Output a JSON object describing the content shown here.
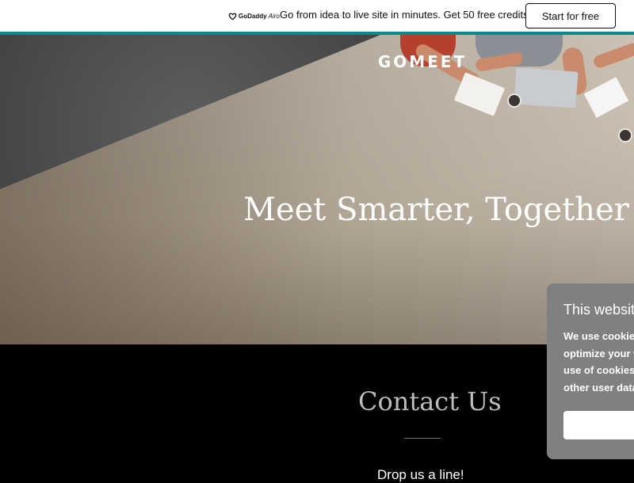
{
  "promo": {
    "logo_text": "GoDaddy",
    "logo_suffix": "Airo",
    "message": "Go from idea to live site in minutes. Get 50 free credits",
    "cta_label": "Start for free",
    "accent_color": "#0b8a8e"
  },
  "hero": {
    "brand": "GOMEET",
    "headline": "Meet Smarter, Together"
  },
  "contact": {
    "title": "Contact Us",
    "subtitle": "Drop us a line!"
  },
  "cookie_banner": {
    "title": "This websit",
    "body_lines": [
      "We use cookies",
      "optimize your w",
      "use of cookies,",
      "other user data"
    ],
    "button_label": "",
    "background_color": "#808080"
  }
}
